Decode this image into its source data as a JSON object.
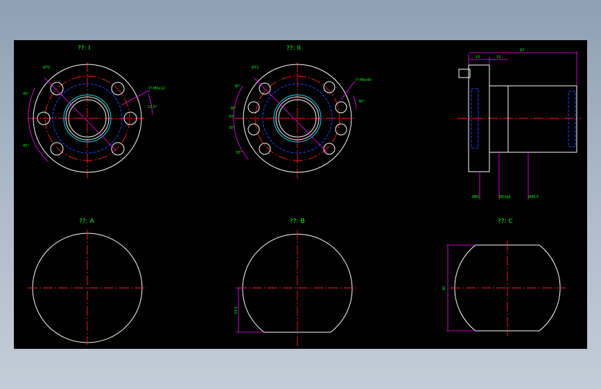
{
  "views": {
    "view_1_title": "??: I",
    "view_2_title": "??: II",
    "view_a_title": "??: A",
    "view_b_title": "??: B",
    "view_c_title": "??: C"
  },
  "dims": {
    "v1_diameter": "Ø72",
    "v1_hole_note": "??-M6x12",
    "v1_angle_1": "45°",
    "v1_angle_2": "45°",
    "v1_angle_3": "22.5°",
    "v2_diameter": "Ø72",
    "v2_hole_note": "??-M6x40",
    "v2_angle_1": "30°",
    "v2_angle_2": "30°",
    "v2_angle_3": "30°",
    "v2_angle_4": "30°",
    "v2_angle_5": "30°",
    "v2_angle_6": "30°",
    "side_total": "87",
    "side_flange": "15",
    "side_offset": "15",
    "side_d1": "Ø85",
    "side_d2": "Ø53g6",
    "side_d3": "Ø49.5",
    "viewb_height": "24.5",
    "viewc_width": "30"
  },
  "colors": {
    "outline": "#ffffff",
    "centerline": "#ff2020",
    "dimension": "#ff00ff",
    "hidden": "#2040ff",
    "thread": "#00e5ff",
    "label": "#00ff00",
    "sheet": "#000000"
  }
}
